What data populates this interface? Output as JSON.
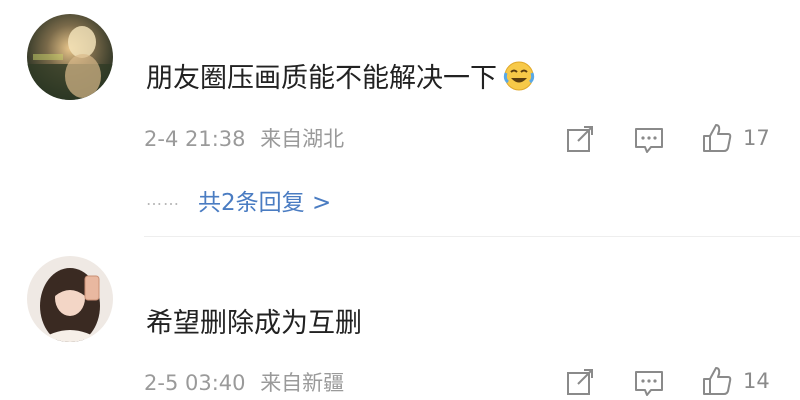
{
  "comments": [
    {
      "text": "朋友圈压画质能不能解决一下",
      "emoji": "laughing-crying-emoji",
      "date_time": "2-4 21:38",
      "location": "来自湖北",
      "likes": "17",
      "replies_label": "共2条回复 >"
    },
    {
      "text": "希望删除成为互删",
      "date_time": "2-5 03:40",
      "location": "来自新疆",
      "likes": "14"
    }
  ],
  "icons": {
    "share": "share-icon",
    "comment": "comment-icon",
    "like": "thumbs-up-icon"
  },
  "colors": {
    "link": "#4a7cc2",
    "meta": "#9a9a9a",
    "text": "#222222"
  }
}
